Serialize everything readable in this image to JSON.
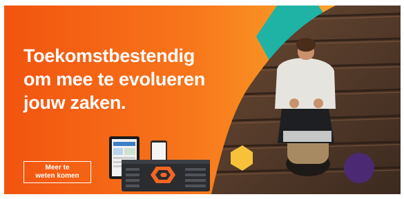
{
  "ad": {
    "headline_lines": [
      "Toekomstbestendig",
      "om mee te evolueren",
      "jouw zaken."
    ],
    "cta_lines": [
      "Meer te",
      "weten komen"
    ]
  },
  "colors": {
    "gradient_start": "#f2540f",
    "gradient_end": "#fbb33a",
    "teal_hexagon": "#1fb3a6",
    "purple_circle": "#4b2a73",
    "yellow_hexagon": "#f7c23a",
    "text": "#ffffff"
  },
  "icons": [
    "pure-storage-logo-icon"
  ]
}
